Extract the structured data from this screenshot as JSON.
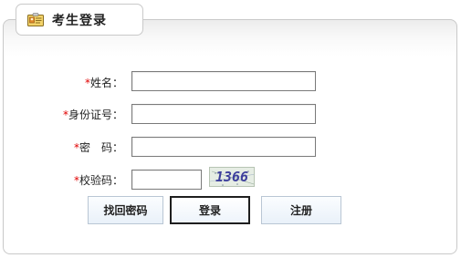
{
  "panel": {
    "title": "考生登录",
    "title_icon": "id-card-icon"
  },
  "form": {
    "name_label": "姓名：",
    "id_label": "身份证号：",
    "password_label": "密　码：",
    "captcha_label": "校验码：",
    "required_mark": "*",
    "name_value": "",
    "id_value": "",
    "password_value": "",
    "captcha_value": "",
    "captcha_image_text": "1366"
  },
  "buttons": {
    "find_password": "找回密码",
    "login": "登录",
    "register": "注册"
  },
  "colors": {
    "required": "#e00000",
    "captcha_text": "#3d3f9c",
    "button_border": "#b9c6d4"
  }
}
